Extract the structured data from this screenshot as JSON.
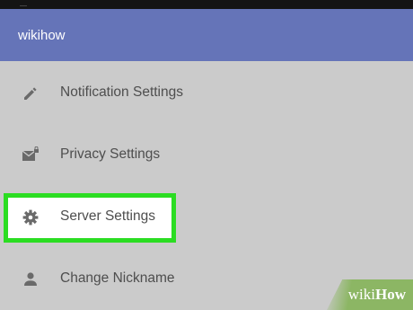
{
  "header": {
    "title": "wikihow"
  },
  "menu": {
    "items": [
      {
        "label": "Notification Settings",
        "icon": "pencil-icon"
      },
      {
        "label": "Privacy Settings",
        "icon": "envelope-lock-icon"
      },
      {
        "label": "Server Settings",
        "icon": "gear-icon",
        "highlighted": true
      },
      {
        "label": "Change Nickname",
        "icon": "person-icon"
      }
    ]
  },
  "colors": {
    "header_bg": "#6574b8",
    "menu_bg": "#cbcbcb",
    "highlight_border": "#2bdd22",
    "text": "#4e4e4e",
    "icon": "#6a6a6a"
  },
  "watermark": {
    "wiki": "wiki",
    "how": "How"
  }
}
